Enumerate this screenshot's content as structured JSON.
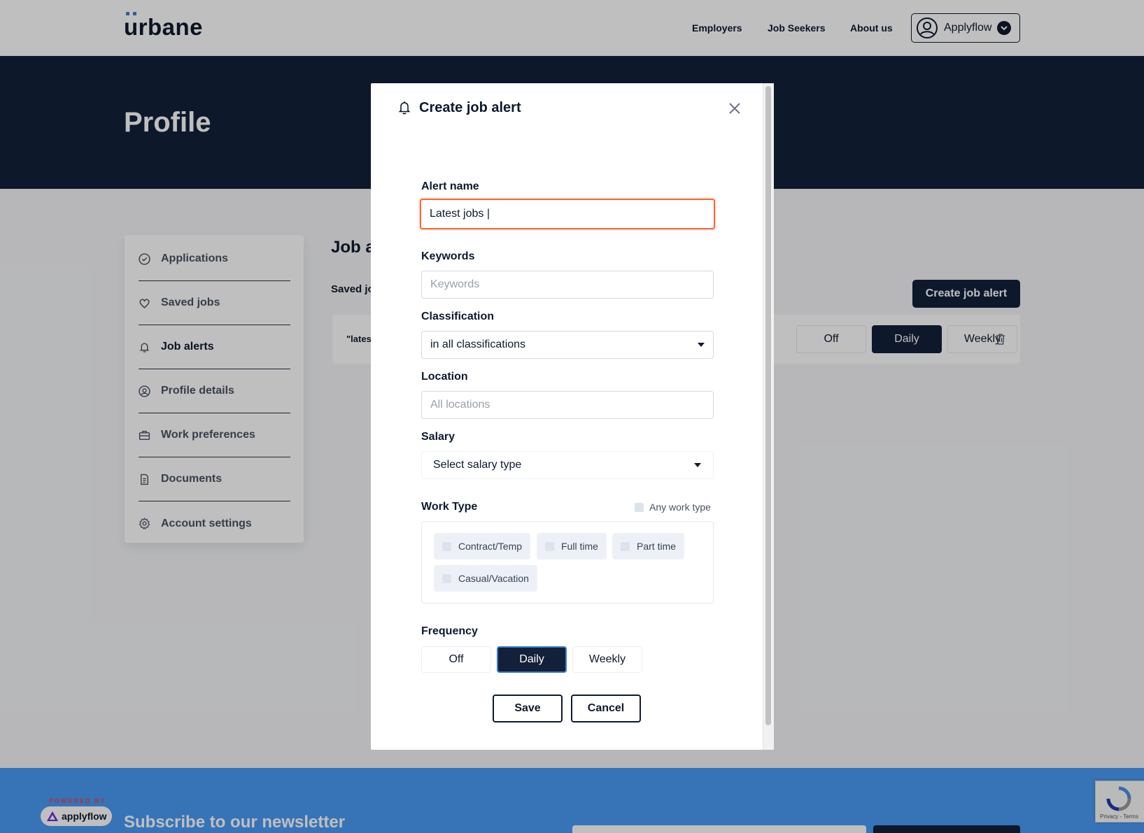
{
  "header": {
    "logo": "urbane",
    "nav": [
      "Employers",
      "Job Seekers",
      "About us"
    ],
    "user_name": "Applyflow"
  },
  "hero": {
    "title": "Profile"
  },
  "sidebar": {
    "items": [
      {
        "label": "Applications",
        "icon": "check-circle-icon"
      },
      {
        "label": "Saved jobs",
        "icon": "heart-icon"
      },
      {
        "label": "Job alerts",
        "icon": "bell-icon",
        "active": true
      },
      {
        "label": "Profile details",
        "icon": "user-circle-icon"
      },
      {
        "label": "Work preferences",
        "icon": "briefcase-icon"
      },
      {
        "label": "Documents",
        "icon": "document-icon"
      },
      {
        "label": "Account settings",
        "icon": "gear-icon"
      }
    ]
  },
  "main": {
    "title": "Job a",
    "subtitle": "Saved jo",
    "create_button": "Create job alert",
    "alert_row": {
      "name": "\"lates",
      "frequency": [
        "Off",
        "Daily",
        "Weekly"
      ],
      "selected": "Daily"
    }
  },
  "modal": {
    "title": "Create job alert",
    "alert_name": {
      "label": "Alert name",
      "value": "Latest jobs |"
    },
    "keywords": {
      "label": "Keywords",
      "placeholder": "Keywords"
    },
    "classification": {
      "label": "Classification",
      "value": "in all classifications"
    },
    "location": {
      "label": "Location",
      "placeholder": "All locations"
    },
    "salary": {
      "label": "Salary",
      "value": "Select salary type"
    },
    "work_type": {
      "label": "Work Type",
      "any_label": "Any work type",
      "options": [
        "Contract/Temp",
        "Full time",
        "Part time",
        "Casual/Vacation"
      ]
    },
    "frequency": {
      "label": "Frequency",
      "options": [
        "Off",
        "Daily",
        "Weekly"
      ],
      "selected": "Daily"
    },
    "save_label": "Save",
    "cancel_label": "Cancel"
  },
  "footer": {
    "powered_by": "POWERED BY",
    "applyflow_logo": "applyflow",
    "newsletter_title": "Subscribe to our newsletter",
    "recaptcha_text": "Privacy - Terms"
  },
  "colors": {
    "navy": "#13203a",
    "accent_blue": "#4a9af4",
    "focus_orange": "#f06a3a"
  }
}
